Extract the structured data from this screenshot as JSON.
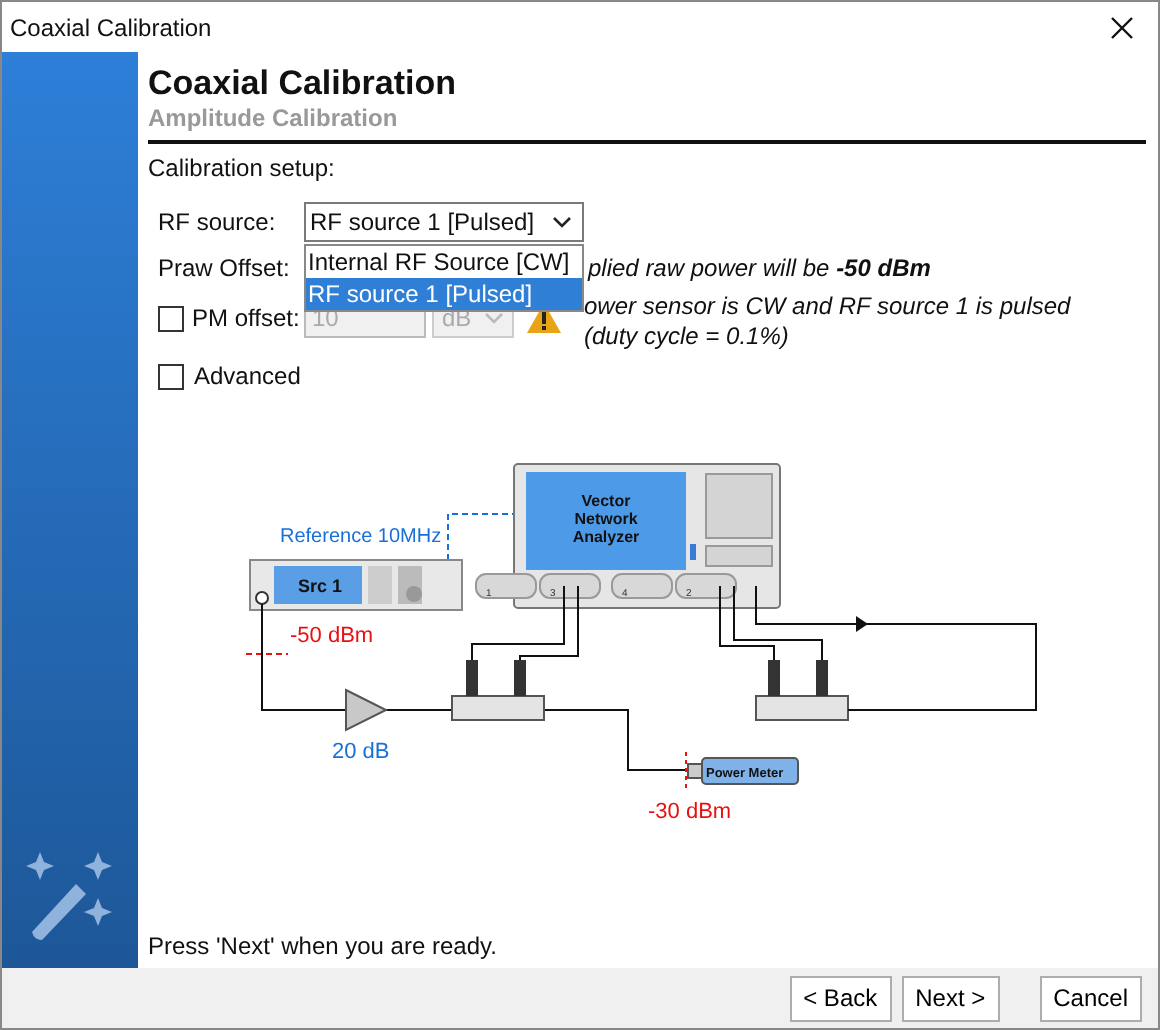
{
  "window": {
    "title": "Coaxial Calibration"
  },
  "header": {
    "title": "Coaxial Calibration",
    "subtitle": "Amplitude Calibration"
  },
  "setup": {
    "heading": "Calibration setup:",
    "rf_source": {
      "label": "RF source:",
      "value": "RF source 1 [Pulsed]",
      "expanded": true,
      "options": [
        {
          "label": "Internal RF Source [CW]",
          "selected": false
        },
        {
          "label": "RF source 1 [Pulsed]",
          "selected": true
        }
      ]
    },
    "praw_offset": {
      "label": "Praw Offset:"
    },
    "pm_offset": {
      "label": "PM offset:",
      "checked": false,
      "disabled": true,
      "value": "10",
      "unit": "dB"
    },
    "advanced": {
      "label": "Advanced",
      "checked": false
    },
    "info": "plied raw power will be **-50 dBm**",
    "warning": [
      "ower sensor is CW and RF source 1 is pulsed",
      "(duty cycle = 0.1%)"
    ]
  },
  "diagram": {
    "reference": "Reference 10MHz",
    "source": "Src 1",
    "analyzer": [
      "Vector",
      "Network",
      "Analyzer"
    ],
    "ports": [
      "1",
      "3",
      "4",
      "2"
    ],
    "source_power": "-50 dBm",
    "gain": "20 dB",
    "power_meter": "Power Meter",
    "meter_power": "-30 dBm"
  },
  "footer": {
    "hint": "Press 'Next' when you are ready."
  },
  "buttons": [
    {
      "label": "< Back"
    },
    {
      "label": "Next >"
    },
    {
      "label": "Cancel"
    }
  ]
}
